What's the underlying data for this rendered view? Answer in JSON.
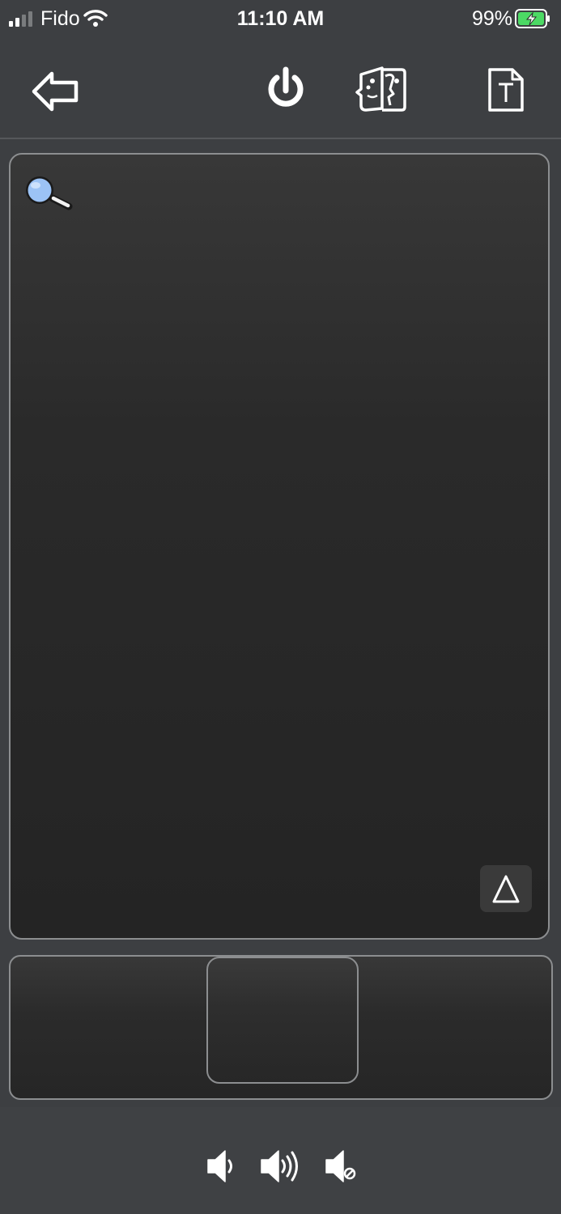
{
  "status_bar": {
    "carrier": "Fido",
    "time": "11:10 AM",
    "battery_percent": "99%",
    "signal_icon": "cellular-signal-icon",
    "wifi_icon": "wifi-icon",
    "battery_icon": "battery-charging-icon",
    "battery_color": "#4cd964"
  },
  "toolbar": {
    "back_icon": "back-arrow-icon",
    "power_icon": "power-icon",
    "faces_icon": "screen-share-faces-icon",
    "text_icon": "text-document-icon"
  },
  "trackpad": {
    "zoom_icon": "magnifier-icon",
    "keyboard_toggle_icon": "triangle-up-icon",
    "keyboard_toggle_symbol": "△"
  },
  "mouse_buttons": {
    "left": "left-mouse-button",
    "middle": "middle-mouse-button",
    "right": "right-mouse-button"
  },
  "volume": {
    "down_icon": "volume-down-icon",
    "up_icon": "volume-up-icon",
    "mute_icon": "volume-mute-icon"
  },
  "colors": {
    "background": "#3d3f42",
    "trackpad_border": "#8c8e90",
    "icon": "#ffffff",
    "magnifier_lens": "#9cc3f5"
  }
}
